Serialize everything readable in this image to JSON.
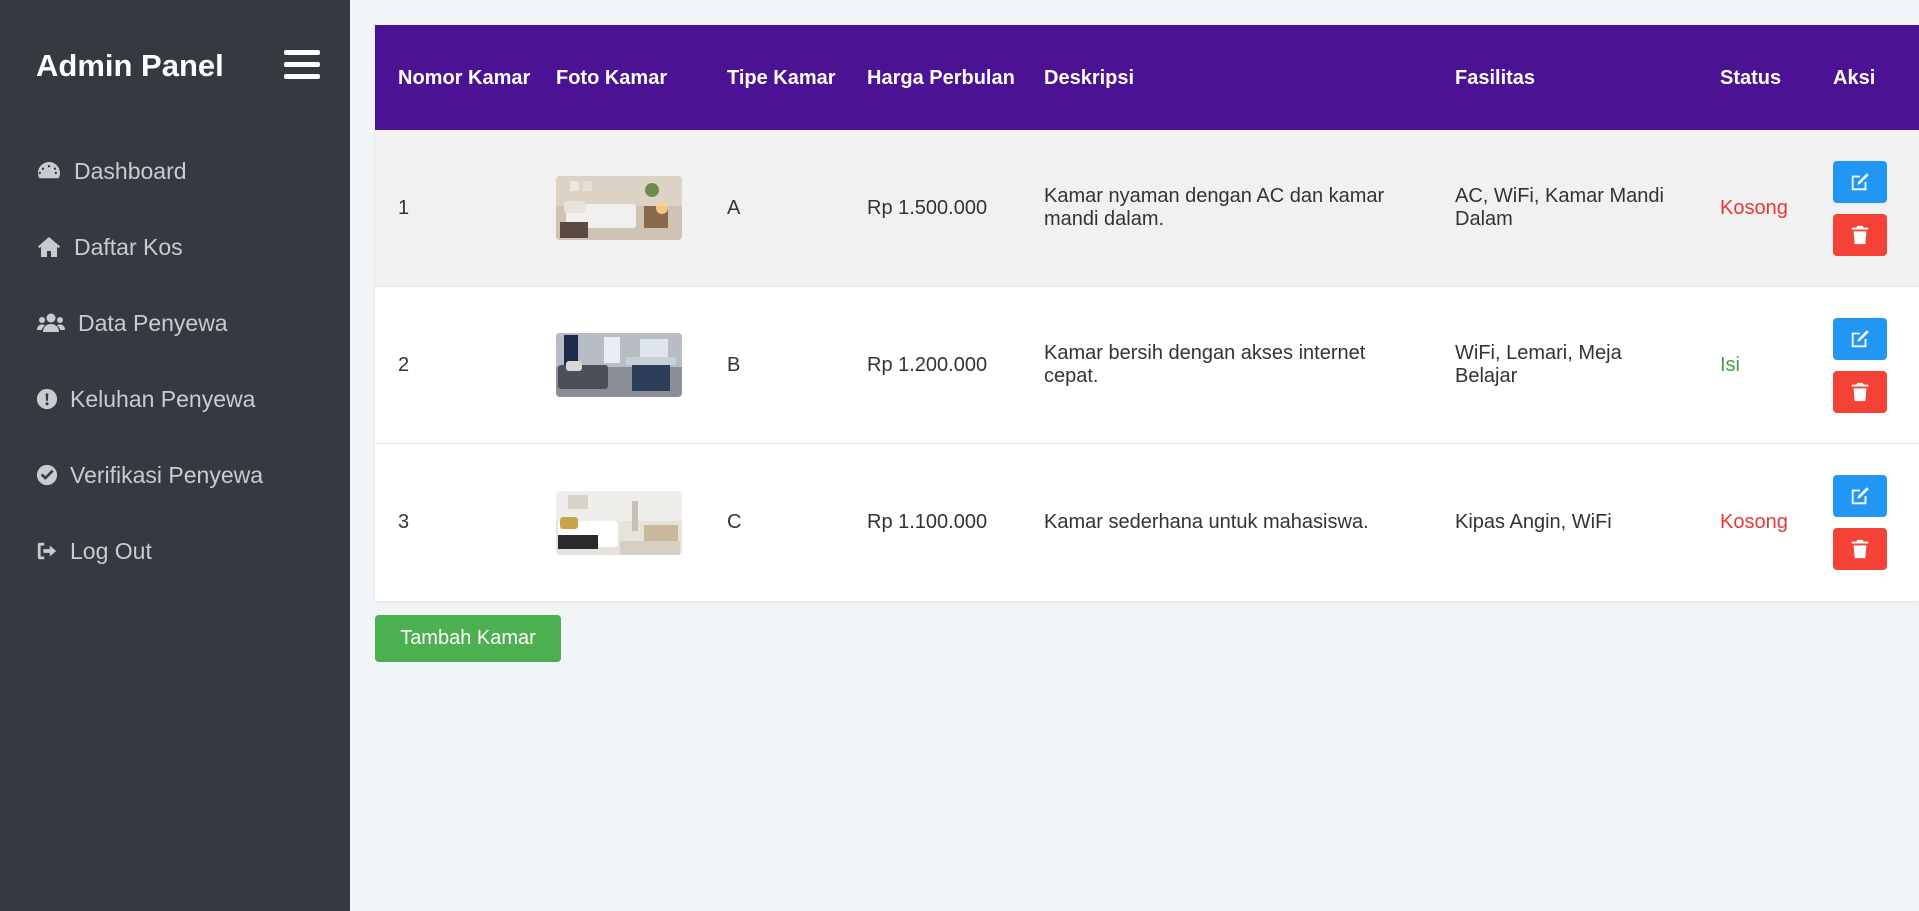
{
  "sidebar": {
    "brand": "Admin Panel",
    "items": [
      {
        "label": "Dashboard",
        "icon": "tachometer-icon"
      },
      {
        "label": "Daftar Kos",
        "icon": "home-icon"
      },
      {
        "label": "Data Penyewa",
        "icon": "users-icon"
      },
      {
        "label": "Keluhan Penyewa",
        "icon": "exclamation-circle-icon"
      },
      {
        "label": "Verifikasi Penyewa",
        "icon": "check-circle-icon"
      },
      {
        "label": "Log Out",
        "icon": "sign-out-icon"
      }
    ]
  },
  "table": {
    "headers": {
      "nomor": "Nomor Kamar",
      "foto": "Foto Kamar",
      "tipe": "Tipe Kamar",
      "harga": "Harga Perbulan",
      "deskripsi": "Deskripsi",
      "fasilitas": "Fasilitas",
      "status": "Status",
      "aksi": "Aksi"
    },
    "rows": [
      {
        "nomor": "1",
        "tipe": "A",
        "harga": "Rp 1.500.000",
        "deskripsi": "Kamar nyaman dengan AC dan kamar mandi dalam.",
        "fasilitas": "AC, WiFi, Kamar Mandi Dalam",
        "status": "Kosong",
        "photo": "bedroom-photo-warm"
      },
      {
        "nomor": "2",
        "tipe": "B",
        "harga": "Rp 1.200.000",
        "deskripsi": "Kamar bersih dengan akses internet cepat.",
        "fasilitas": "WiFi, Lemari, Meja Belajar",
        "status": "Isi",
        "photo": "bedroom-photo-navy"
      },
      {
        "nomor": "3",
        "tipe": "C",
        "harga": "Rp 1.100.000",
        "deskripsi": "Kamar sederhana untuk mahasiswa.",
        "fasilitas": "Kipas Angin, WiFi",
        "status": "Kosong",
        "photo": "bedroom-photo-white"
      }
    ]
  },
  "add_button": "Tambah Kamar",
  "colors": {
    "sidebar_bg": "#343a40",
    "header_bg": "#4b1393",
    "status_empty": "#e53935",
    "status_filled": "#43a047",
    "edit_button": "#2196f3",
    "delete_button": "#f44336",
    "add_button": "#4caf50"
  }
}
